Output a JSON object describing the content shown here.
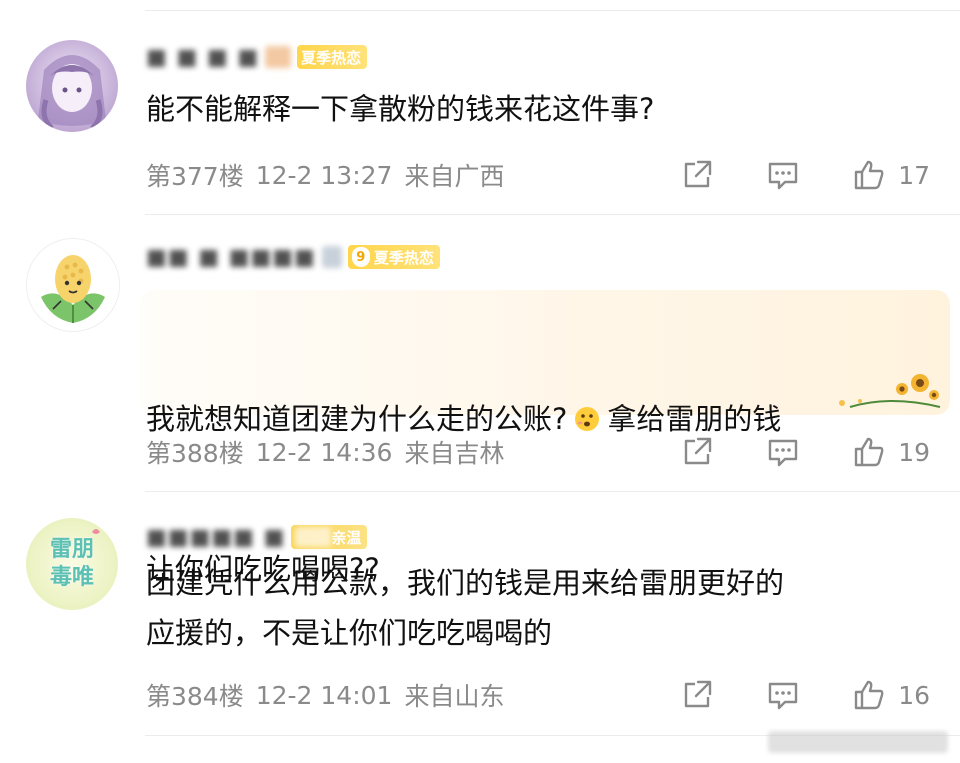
{
  "comments": [
    {
      "badge_label": "夏季热恋",
      "text": "能不能解释一下拿散粉的钱来花这件事?",
      "floor": "第377楼",
      "date": "12-2 13:27",
      "location": "来自广西",
      "likes": "17"
    },
    {
      "badge_level": "9",
      "badge_label": "夏季热恋",
      "text_line1": "我就想知道团建为什么走的公账?",
      "text_line1b": "拿给雷朋的钱",
      "text_line2": "让你们吃吃喝喝??",
      "floor": "第388楼",
      "date": "12-2 14:36",
      "location": "来自吉林",
      "likes": "19"
    },
    {
      "avatar_text": "雷朋\n毒唯",
      "badge_label": "亲温",
      "text": "团建凭什么用公款，我们的钱是用来给雷朋更好的\n应援的，不是让你们吃吃喝喝的",
      "floor": "第384楼",
      "date": "12-2 14:01",
      "location": "来自山东",
      "likes": "16"
    }
  ],
  "icons": {
    "repost": "share-out-icon",
    "comment": "comment-bubble-icon",
    "like": "thumbs-up-icon",
    "emoji": "thinking-face-emoji"
  },
  "colors": {
    "badge_yellow": "#ffd54a",
    "meta_grey": "#8a8a8a",
    "divider": "#ececec"
  }
}
